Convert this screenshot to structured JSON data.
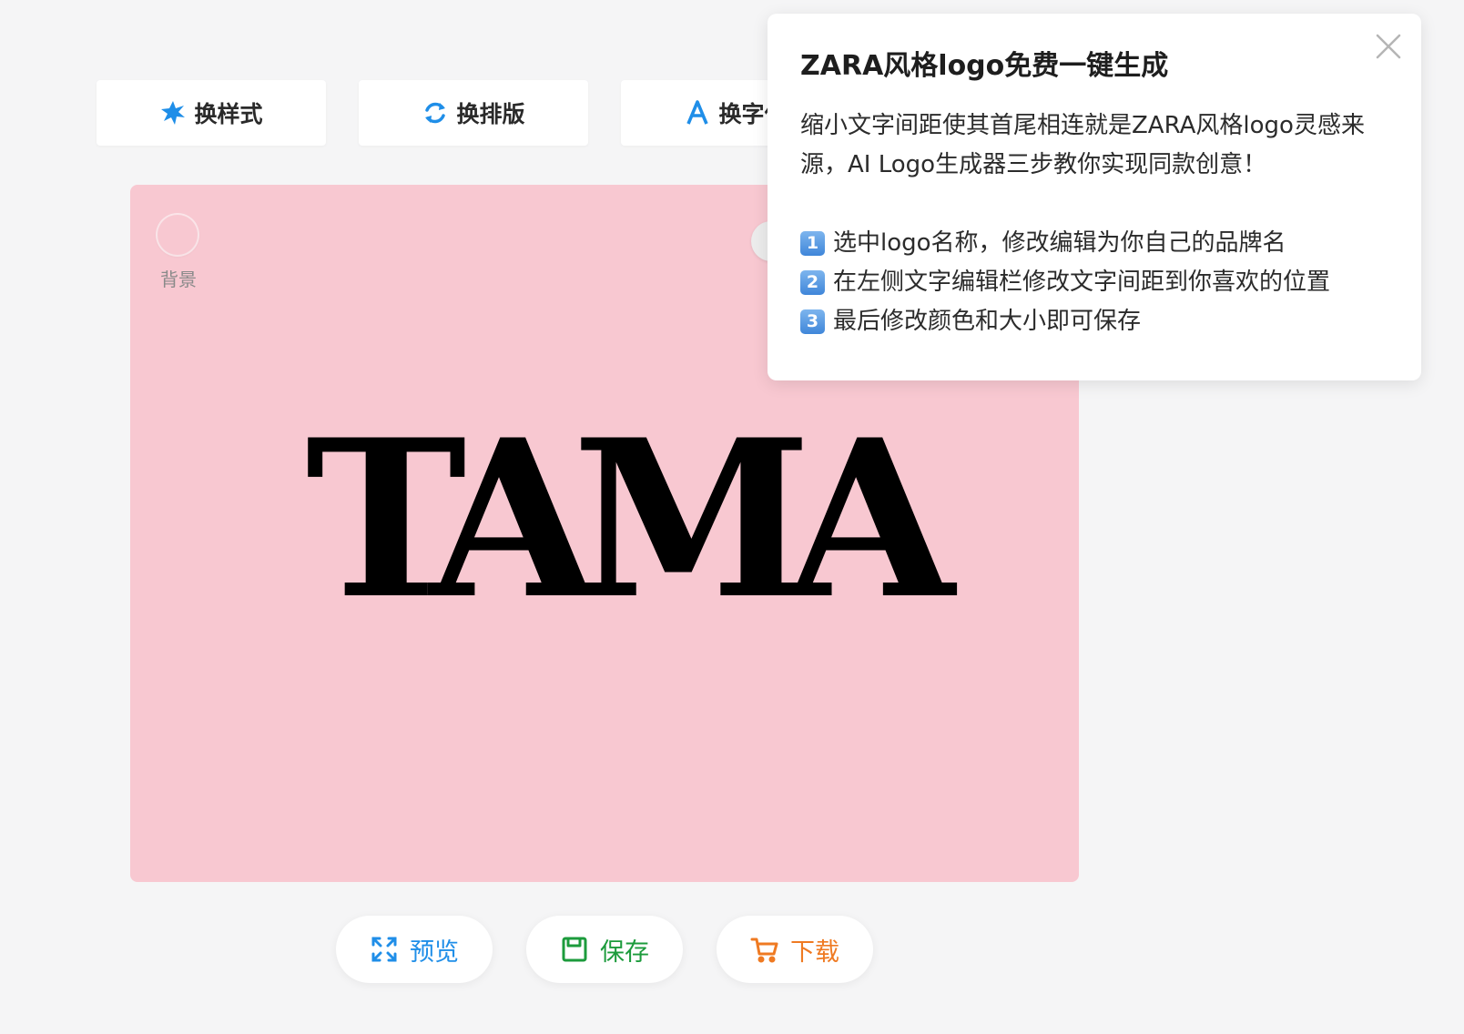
{
  "toolbar": {
    "style_label": "换样式",
    "layout_label": "换排版",
    "font_label": "换字体",
    "icon_color": "#1f8ee8"
  },
  "canvas": {
    "background_color": "#f8c8d1",
    "background_label": "背景",
    "logo_text": "TAMA",
    "logo_color": "#000000"
  },
  "actions": {
    "preview_label": "预览",
    "save_label": "保存",
    "download_label": "下载",
    "preview_color": "#1f8ee8",
    "save_color": "#1c9b3c",
    "download_color": "#ef7a22"
  },
  "popup": {
    "title": "ZARA风格logo免费一键生成",
    "description": "缩小文字间距使其首尾相连就是ZARA风格logo灵感来源，AI Logo生成器三步教你实现同款创意！",
    "steps": [
      {
        "num": "1",
        "text": "选中logo名称，修改编辑为你自己的品牌名"
      },
      {
        "num": "2",
        "text": "在左侧文字编辑栏修改文字间距到你喜欢的位置"
      },
      {
        "num": "3",
        "text": "最后修改颜色和大小即可保存"
      }
    ]
  },
  "icons": {
    "style": "star-burst-icon",
    "layout": "refresh-icon",
    "font": "letter-a-icon",
    "preview": "expand-icon",
    "save": "floppy-disk-icon",
    "download": "shopping-cart-icon",
    "close": "close-icon"
  }
}
